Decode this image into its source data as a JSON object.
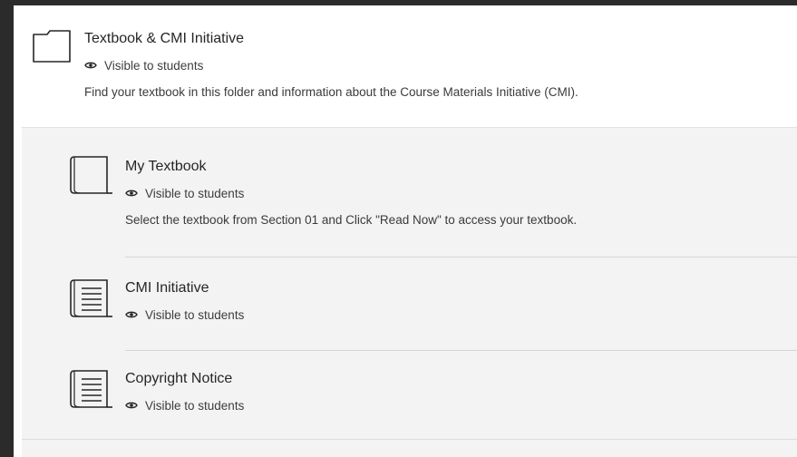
{
  "folder": {
    "title": "Textbook & CMI Initiative",
    "visibility": "Visible to students",
    "description": "Find your textbook in this folder and information about the Course Materials Initiative (CMI).",
    "icon": "folder-icon"
  },
  "items": [
    {
      "title": "My Textbook",
      "visibility": "Visible to students",
      "description": "Select the textbook from Section 01 and Click \"Read Now\" to access your textbook.",
      "icon": "blank-document-icon"
    },
    {
      "title": "CMI Initiative",
      "visibility": "Visible to students",
      "icon": "text-document-icon"
    },
    {
      "title": "Copyright Notice",
      "visibility": "Visible to students",
      "icon": "text-document-icon"
    }
  ],
  "colors": {
    "background": "#2b2b2b",
    "panel": "#ffffff",
    "children_bg": "#f3f3f3",
    "text": "#262626"
  }
}
